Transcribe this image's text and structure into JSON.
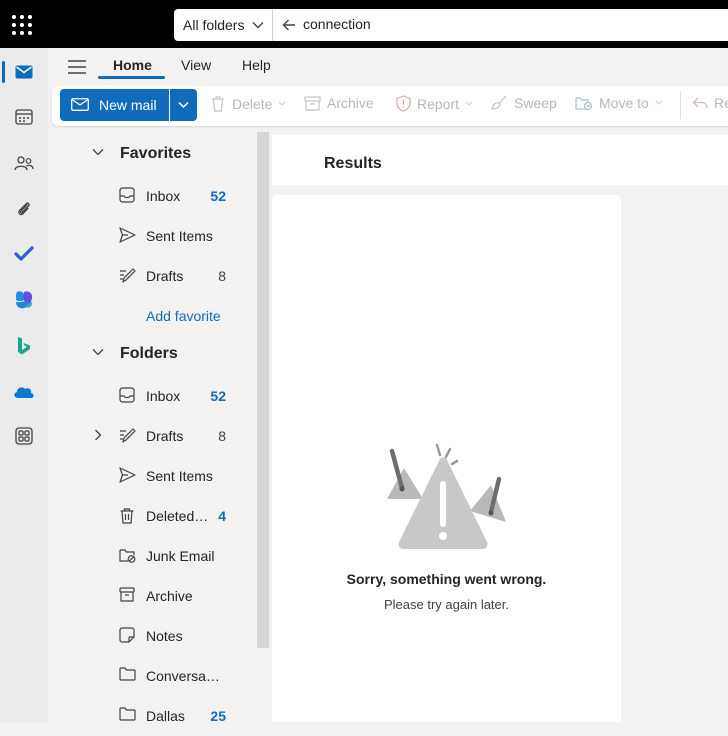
{
  "search": {
    "scope": "All folders",
    "query": "connection"
  },
  "ribbon": {
    "tabs": [
      "Home",
      "View",
      "Help"
    ],
    "active_tab": "Home",
    "new_mail_label": "New mail",
    "actions": [
      "Delete",
      "Archive",
      "Report",
      "Sweep",
      "Move to",
      "Re"
    ]
  },
  "folders": {
    "favorites_header": "Favorites",
    "favorites": [
      {
        "name": "Inbox",
        "count": "52",
        "count_style": "unread",
        "icon": "inbox-icon"
      },
      {
        "name": "Sent Items",
        "count": "",
        "icon": "sent-icon"
      },
      {
        "name": "Drafts",
        "count": "8",
        "count_style": "total",
        "icon": "drafts-icon"
      }
    ],
    "add_favorite": "Add favorite",
    "folders_header": "Folders",
    "items": [
      {
        "name": "Inbox",
        "count": "52",
        "count_style": "unread",
        "icon": "inbox-icon"
      },
      {
        "name": "Drafts",
        "count": "8",
        "count_style": "total",
        "icon": "drafts-icon"
      },
      {
        "name": "Sent Items",
        "count": "",
        "icon": "sent-icon"
      },
      {
        "name": "Deleted Items",
        "count": "4",
        "count_style": "unread",
        "icon": "trash-icon"
      },
      {
        "name": "Junk Email",
        "count": "",
        "icon": "junk-icon"
      },
      {
        "name": "Archive",
        "count": "",
        "icon": "archive-icon"
      },
      {
        "name": "Notes",
        "count": "",
        "icon": "notes-icon"
      },
      {
        "name": "Conversation History",
        "count": "",
        "icon": "folder-icon"
      },
      {
        "name": "Dallas",
        "count": "25",
        "count_style": "unread",
        "icon": "folder-icon"
      }
    ]
  },
  "results": {
    "title": "Results",
    "error_title": "Sorry, something went wrong.",
    "error_subtitle": "Please try again later."
  },
  "colors": {
    "accent": "#0f6cbd",
    "topbar": "#000000",
    "pane": "#f3f2f1"
  }
}
